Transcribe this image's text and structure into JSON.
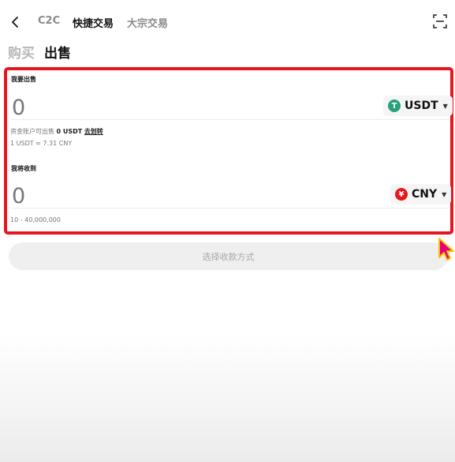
{
  "nav": {
    "tabs": [
      {
        "label": "C2C",
        "active": false
      },
      {
        "label": "快捷交易",
        "active": true
      },
      {
        "label": "大宗交易",
        "active": false
      }
    ]
  },
  "trade_tabs": [
    {
      "label": "购买",
      "active": false
    },
    {
      "label": "出售",
      "active": true
    }
  ],
  "sell": {
    "label": "我要出售",
    "amount_placeholder": "0",
    "currency": "USDT",
    "balance_prefix": "资金账户可出售",
    "balance_value": "0 USDT",
    "transfer_link": "去划转",
    "rate": "1 USDT ≈ 7.31 CNY"
  },
  "receive": {
    "label": "我将收到",
    "amount_placeholder": "0",
    "currency": "CNY",
    "currency_symbol": "¥",
    "range": "10 - 40,000,000"
  },
  "submit_label": "选择收款方式",
  "colors": {
    "highlight_border": "#e8171f",
    "usdt_icon": "#26a17b",
    "cny_icon": "#e8171f",
    "cursor": "#e6007e"
  }
}
